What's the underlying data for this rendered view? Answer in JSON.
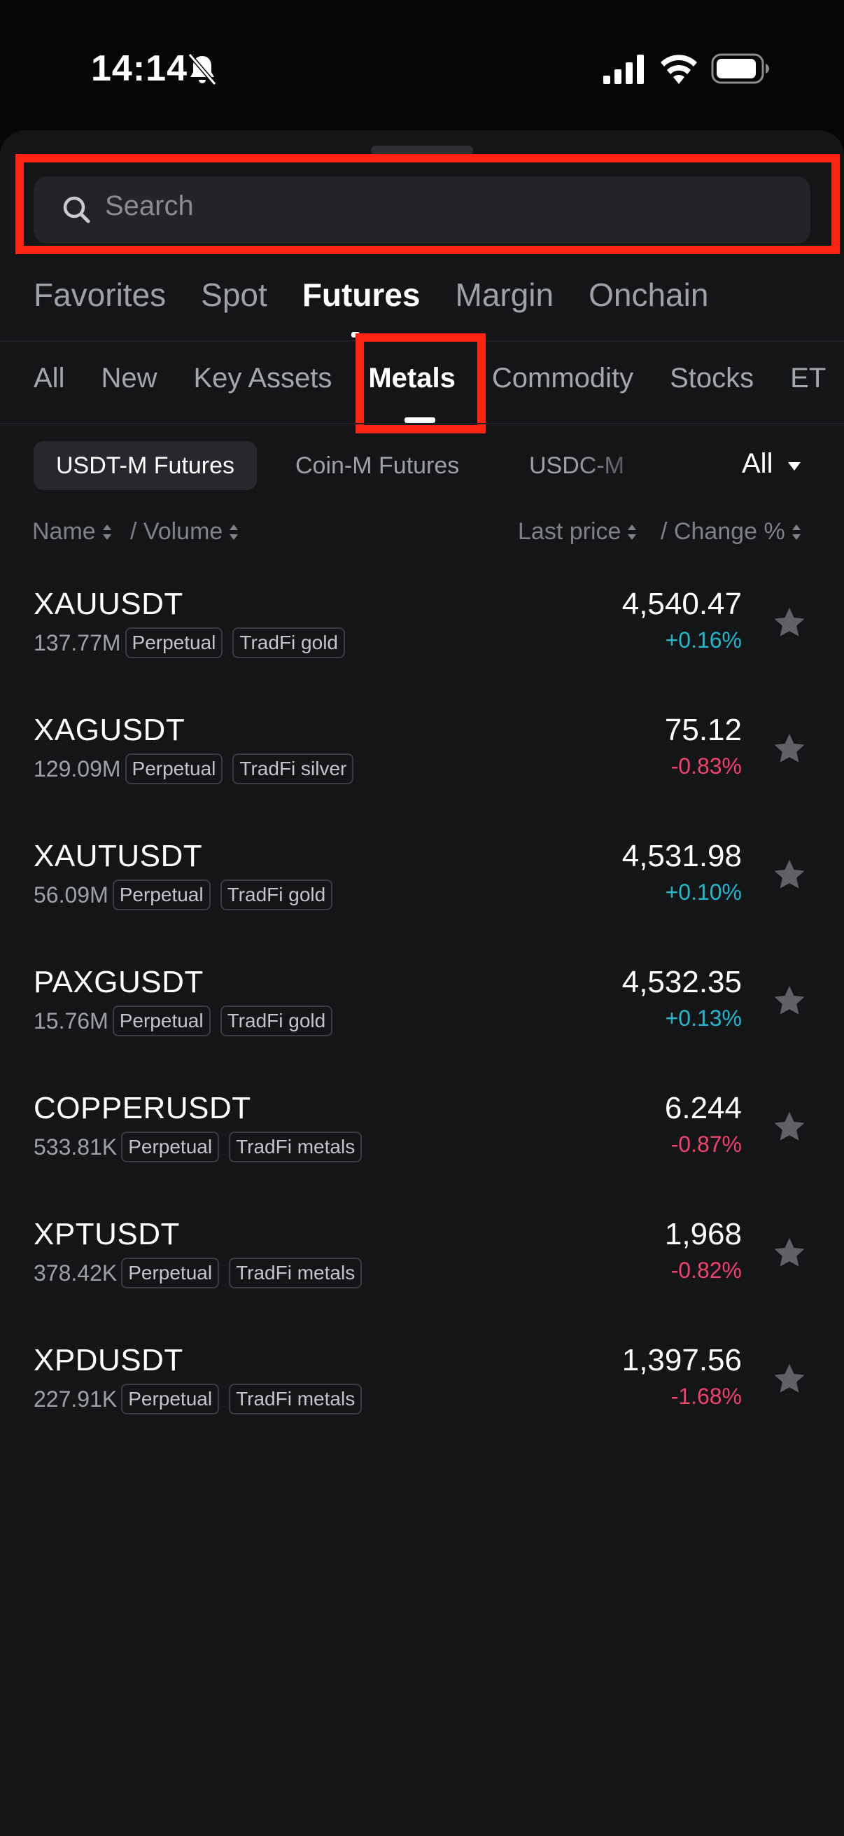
{
  "status_bar": {
    "time": "14:14"
  },
  "search": {
    "placeholder": "Search"
  },
  "main_tabs": [
    {
      "label": "Favorites",
      "active": false
    },
    {
      "label": "Spot",
      "active": false
    },
    {
      "label": "Futures",
      "active": true
    },
    {
      "label": "Margin",
      "active": false
    },
    {
      "label": "Onchain",
      "active": false
    }
  ],
  "sub_tabs": [
    {
      "label": "All",
      "active": false
    },
    {
      "label": "New",
      "active": false
    },
    {
      "label": "Key Assets",
      "active": false
    },
    {
      "label": "Metals",
      "active": true
    },
    {
      "label": "Commodity",
      "active": false
    },
    {
      "label": "Stocks",
      "active": false
    },
    {
      "label": "ET",
      "active": false
    }
  ],
  "type_chips": [
    {
      "label": "USDT-M Futures",
      "active": true
    },
    {
      "label": "Coin-M Futures",
      "active": false
    },
    {
      "label": "USDC-M",
      "active": false
    }
  ],
  "filter": {
    "label": "All"
  },
  "columns": {
    "name": "Name",
    "volume": "/ Volume",
    "last_price": "Last price",
    "change": "/ Change %"
  },
  "rows": [
    {
      "symbol": "XAUUSDT",
      "volume": "137.77M",
      "tags": [
        "Perpetual",
        "TradFi gold"
      ],
      "price": "4,540.47",
      "change": "+0.16%",
      "direction": "up"
    },
    {
      "symbol": "XAGUSDT",
      "volume": "129.09M",
      "tags": [
        "Perpetual",
        "TradFi silver"
      ],
      "price": "75.12",
      "change": "-0.83%",
      "direction": "down"
    },
    {
      "symbol": "XAUTUSDT",
      "volume": "56.09M",
      "tags": [
        "Perpetual",
        "TradFi gold"
      ],
      "price": "4,531.98",
      "change": "+0.10%",
      "direction": "up"
    },
    {
      "symbol": "PAXGUSDT",
      "volume": "15.76M",
      "tags": [
        "Perpetual",
        "TradFi gold"
      ],
      "price": "4,532.35",
      "change": "+0.13%",
      "direction": "up"
    },
    {
      "symbol": "COPPERUSDT",
      "volume": "533.81K",
      "tags": [
        "Perpetual",
        "TradFi metals"
      ],
      "price": "6.244",
      "change": "-0.87%",
      "direction": "down"
    },
    {
      "symbol": "XPTUSDT",
      "volume": "378.42K",
      "tags": [
        "Perpetual",
        "TradFi metals"
      ],
      "price": "1,968",
      "change": "-0.82%",
      "direction": "down"
    },
    {
      "symbol": "XPDUSDT",
      "volume": "227.91K",
      "tags": [
        "Perpetual",
        "TradFi metals"
      ],
      "price": "1,397.56",
      "change": "-1.68%",
      "direction": "down"
    }
  ],
  "colors": {
    "background": "#141517",
    "up": "#1fb8cf",
    "down": "#f0416b",
    "highlight": "#ff2412"
  }
}
